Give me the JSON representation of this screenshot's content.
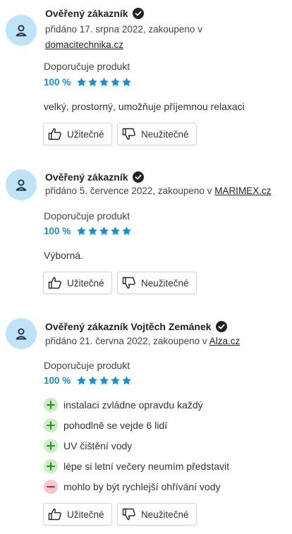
{
  "colors": {
    "accent": "#1a8fc9",
    "star": "#1a8fc9",
    "avatar_bg": "#bfe3f7",
    "pro": "#3aa33a",
    "con": "#d23c4e"
  },
  "icons": {
    "avatar": "user-icon",
    "verified": "check-circle-icon",
    "helpful": "thumbs-up-icon",
    "unhelpful": "thumbs-down-icon",
    "pro": "plus-icon",
    "con": "minus-icon",
    "star": "star-icon"
  },
  "reviews": [
    {
      "author": "Ověřený zákazník",
      "meta_prefix": "přidáno 17. srpna 2022, zakoupeno v",
      "shop": "domacitechnika.cz",
      "recommend": "Doporučuje produkt",
      "rating_pct": "100 %",
      "stars": 5,
      "text": "velký, prostorný, umožňuje příjemnou relaxaci",
      "helpful_label": "Užitečné",
      "unhelpful_label": "Neužitečné"
    },
    {
      "author": "Ověřený zákazník",
      "meta_prefix": "přidáno 5. července 2022, zakoupeno v",
      "shop": "MARIMEX.cz",
      "recommend": "Doporučuje produkt",
      "rating_pct": "100 %",
      "stars": 5,
      "text": "Výborná.",
      "helpful_label": "Užitečné",
      "unhelpful_label": "Neužitečné"
    },
    {
      "author": "Ověřený zákazník Vojtěch Zemánek",
      "meta_prefix": "přidáno 21. června 2022, zakoupeno v",
      "shop": "Alza.cz",
      "recommend": "Doporučuje produkt",
      "rating_pct": "100 %",
      "stars": 5,
      "pros": [
        "instalaci zvládne opravdu každý",
        "pohodlně se vejde 6 lidí",
        "UV čištění vody",
        "lépe si letní večery neumím představit"
      ],
      "cons": [
        "mohlo by být rychlejší ohřívání vody"
      ],
      "helpful_label": "Užitečné",
      "unhelpful_label": "Neužitečné"
    }
  ]
}
